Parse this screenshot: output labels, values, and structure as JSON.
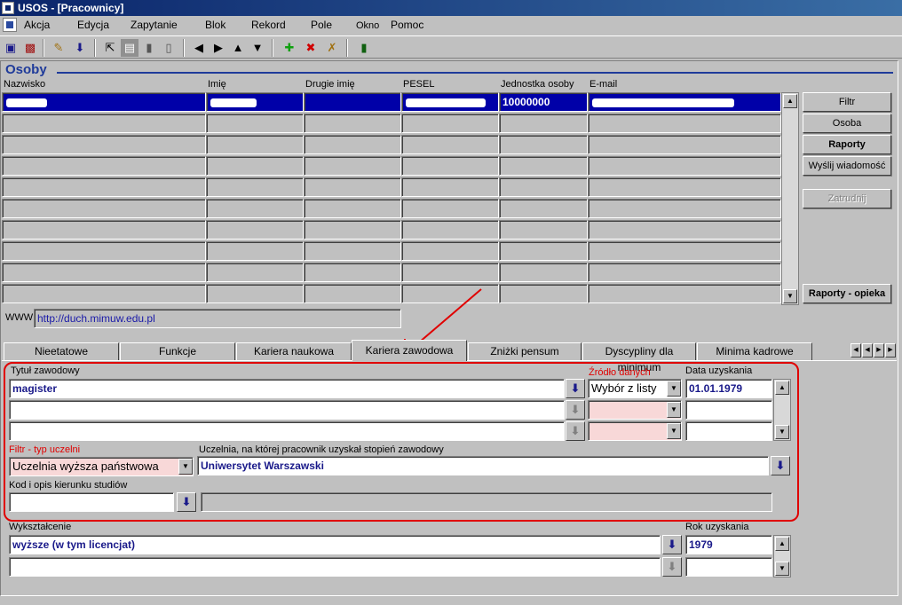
{
  "window": {
    "title": "USOS - [Pracownicy]"
  },
  "menu": [
    "Akcja",
    "Edycja",
    "Zapytanie",
    "Blok",
    "Rekord",
    "Pole",
    "Okno",
    "Pomoc"
  ],
  "section": {
    "title": "Osoby"
  },
  "grid": {
    "columns": [
      "Nazwisko",
      "Imię",
      "Drugie imię",
      "PESEL",
      "Jednostka osoby",
      "E-mail"
    ],
    "selected_row": {
      "jednostka": "10000000"
    }
  },
  "side_buttons": {
    "filtr": "Filtr",
    "osoba": "Osoba",
    "raporty": "Raporty",
    "wyslij": "Wyślij wiadomość",
    "zatrudnij": "Zatrudnij",
    "raporty_opieka": "Raporty - opieka"
  },
  "www": {
    "label": "WWW",
    "value": "http://duch.mimuw.edu.pl"
  },
  "tabs": [
    "Nieetatowe",
    "Funkcje",
    "Kariera naukowa",
    "Kariera zawodowa",
    "Zniżki pensum",
    "Dyscypliny dla minimum",
    "Minima kadrowe"
  ],
  "active_tab": "Kariera zawodowa",
  "form": {
    "tytul_label": "Tytuł zawodowy",
    "zrodlo_label": "Źródło danych",
    "data_label": "Data uzyskania",
    "tytul_value": "magister",
    "zrodlo_value": "Wybór z listy",
    "data_value": "01.01.1979",
    "filtr_label": "Filtr - typ uczelni",
    "filtr_value": "Uczelnia wyższa państwowa",
    "uczelnia_label": "Uczelnia, na której pracownik uzyskał stopień zawodowy",
    "uczelnia_value": "Uniwersytet Warszawski",
    "kod_label": "Kod i opis kierunku studiów",
    "wyksztalcenie_label": "Wykształcenie",
    "wyksztalcenie_value": "wyższe (w tym licencjat)",
    "rok_label": "Rok uzyskania",
    "rok_value": "1979"
  },
  "colors": {
    "selection": "#0000a8",
    "annotation": "#e00000",
    "title_blue": "#1f3b9a"
  }
}
